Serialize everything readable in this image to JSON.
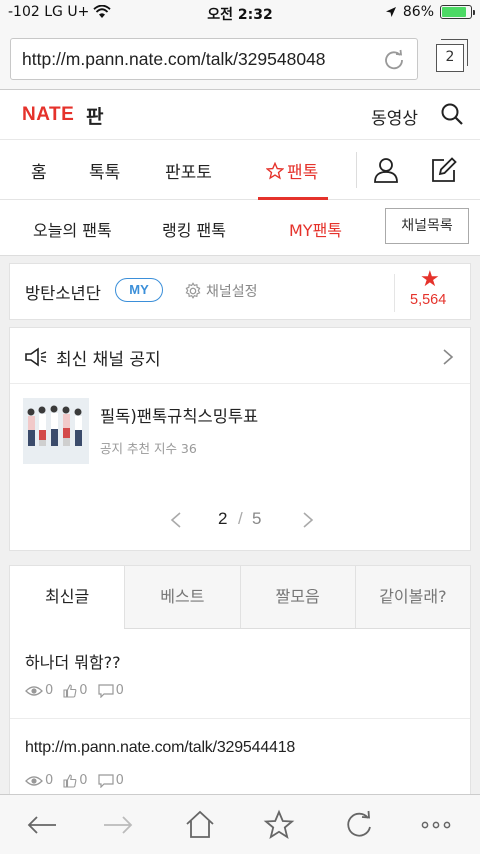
{
  "status_bar": {
    "carrier": "-102 LG U+",
    "time": "오전 2:32",
    "battery": "86%",
    "battery_level": 0.86
  },
  "browser": {
    "url": "http://m.pann.nate.com/talk/329548048",
    "tab_count": "2"
  },
  "header": {
    "logo": "NATE",
    "section": "판",
    "video_link": "동영상"
  },
  "main_nav": {
    "items": [
      "홈",
      "톡톡",
      "판포토",
      "팬톡"
    ]
  },
  "sub_nav": {
    "items": [
      "오늘의 팬톡",
      "랭킹 팬톡",
      "MY팬톡"
    ],
    "channel_list": "채널목록"
  },
  "channel": {
    "name": "방탄소년단",
    "badge": "MY",
    "settings": "채널설정",
    "fan_count": "5,564"
  },
  "notice": {
    "heading": "최신 채널 공지",
    "post_title": "필독)팬톡규칙스밍투표",
    "post_meta": "공지 추천 지수 36",
    "page_current": "2",
    "page_separator": "/",
    "page_total": "5"
  },
  "list": {
    "tabs": [
      "최신글",
      "베스트",
      "짤모음",
      "같이볼래?"
    ],
    "posts": [
      {
        "title": "하나더 뭐함??",
        "views": "0",
        "likes": "0",
        "comments": "0"
      },
      {
        "title": "http://m.pann.nate.com/talk/329544418",
        "views": "0",
        "likes": "0",
        "comments": "0"
      }
    ]
  },
  "colors": {
    "accent": "#e5322b",
    "badge_blue": "#3b8fd9"
  }
}
